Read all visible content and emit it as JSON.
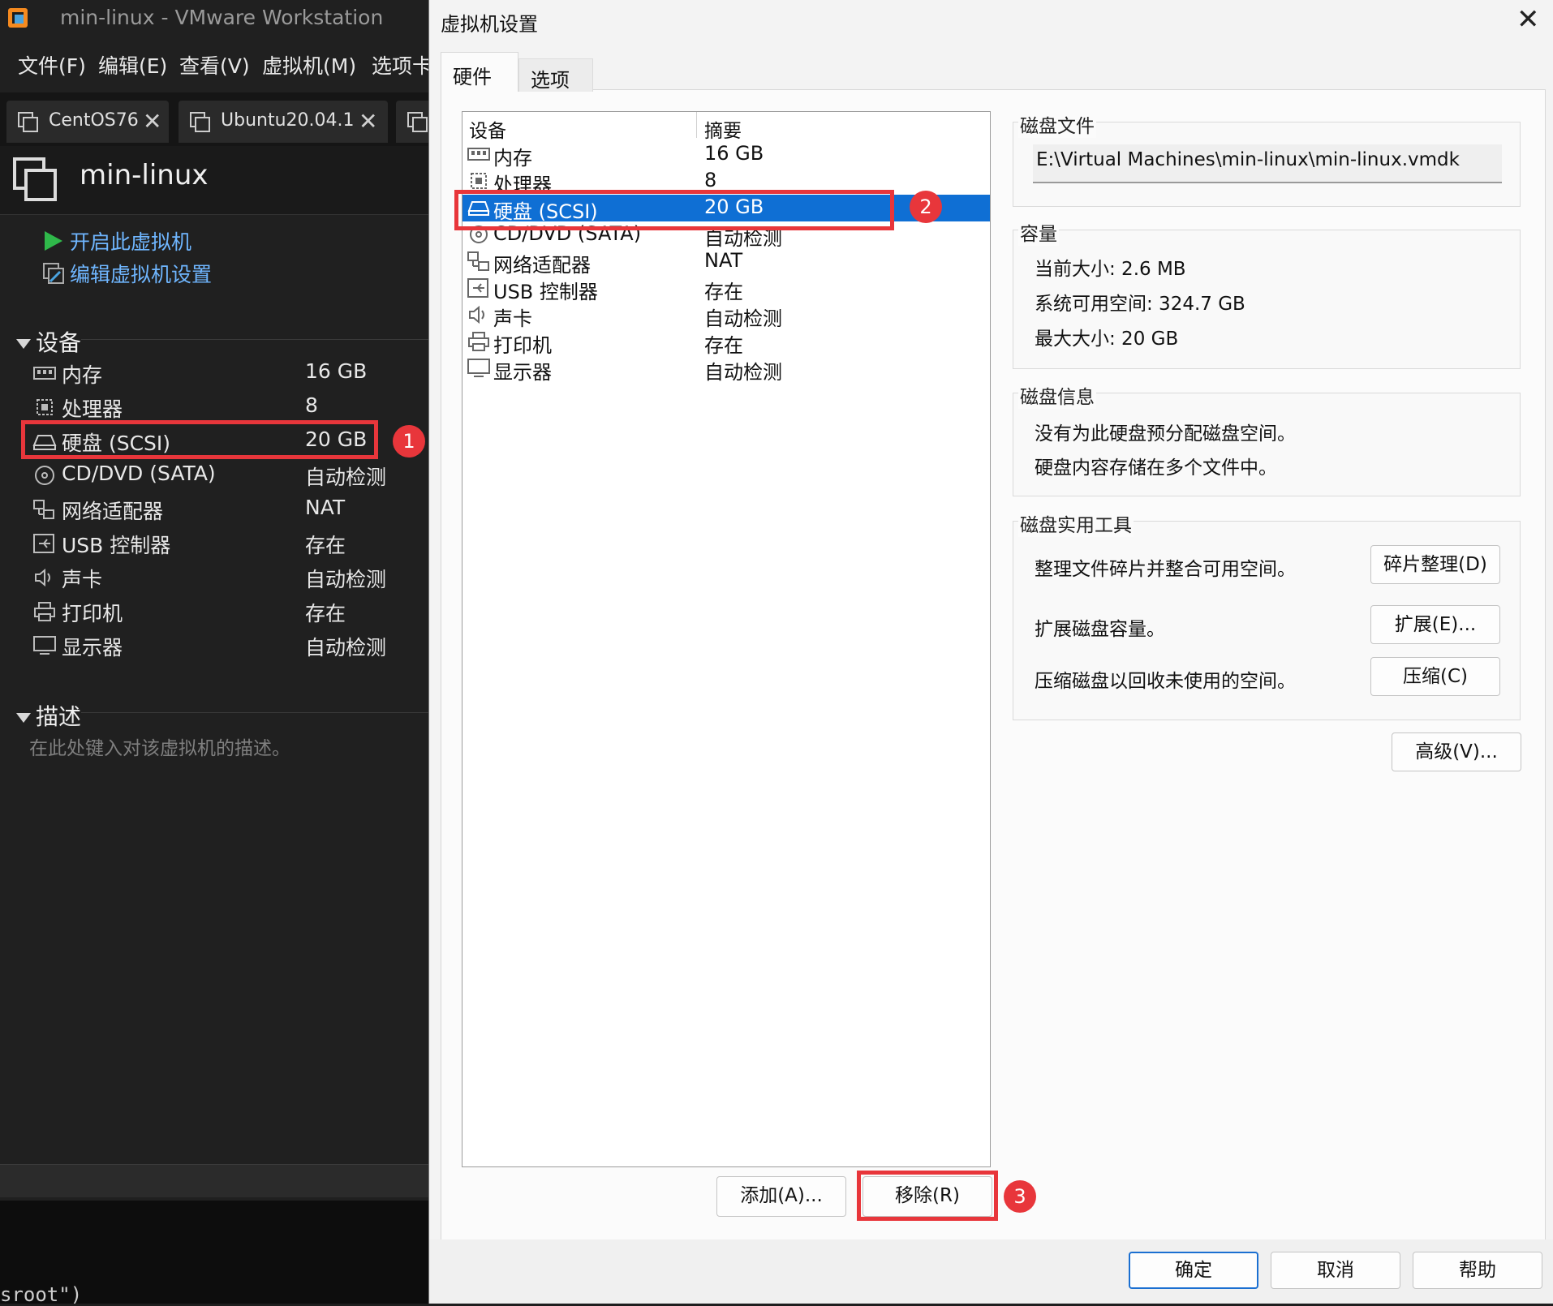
{
  "vmware": {
    "title": "min-linux - VMware Workstation",
    "menu": [
      "文件(F)",
      "编辑(E)",
      "查看(V)",
      "虚拟机(M)",
      "选项卡"
    ],
    "tabs": [
      "CentOS76",
      "Ubuntu20.04.1"
    ],
    "close_glyph": "✕",
    "vm_name": "min-linux",
    "actions": [
      "开启此虚拟机",
      "编辑虚拟机设置"
    ],
    "devices_header": "设备",
    "devices": [
      {
        "name": "内存",
        "value": "16 GB",
        "icon": "memory-icon"
      },
      {
        "name": "处理器",
        "value": "8",
        "icon": "cpu-icon"
      },
      {
        "name": "硬盘 (SCSI)",
        "value": "20 GB",
        "icon": "harddisk-icon"
      },
      {
        "name": "CD/DVD (SATA)",
        "value": "自动检测",
        "icon": "cdrom-icon"
      },
      {
        "name": "网络适配器",
        "value": "NAT",
        "icon": "network-icon"
      },
      {
        "name": "USB 控制器",
        "value": "存在",
        "icon": "usb-icon"
      },
      {
        "name": "声卡",
        "value": "自动检测",
        "icon": "sound-icon"
      },
      {
        "name": "打印机",
        "value": "存在",
        "icon": "printer-icon"
      },
      {
        "name": "显示器",
        "value": "自动检测",
        "icon": "monitor-icon"
      }
    ],
    "description_header": "描述",
    "description_placeholder": "在此处键入对该虚拟机的描述。",
    "console_text": "sroot\")"
  },
  "dialog": {
    "title": "虚拟机设置",
    "close_glyph": "✕",
    "tabs": [
      "硬件",
      "选项"
    ],
    "list_headers": [
      "设备",
      "摘要"
    ],
    "devices": [
      {
        "name": "内存",
        "value": "16 GB"
      },
      {
        "name": "处理器",
        "value": "8"
      },
      {
        "name": "硬盘 (SCSI)",
        "value": "20 GB"
      },
      {
        "name": "CD/DVD (SATA)",
        "value": "自动检测"
      },
      {
        "name": "网络适配器",
        "value": "NAT"
      },
      {
        "name": "USB 控制器",
        "value": "存在"
      },
      {
        "name": "声卡",
        "value": "自动检测"
      },
      {
        "name": "打印机",
        "value": "存在"
      },
      {
        "name": "显示器",
        "value": "自动检测"
      }
    ],
    "selected_index": 2,
    "disk_file": {
      "label": "磁盘文件",
      "path": "E:\\Virtual Machines\\min-linux\\min-linux.vmdk"
    },
    "capacity": {
      "label": "容量",
      "current": "当前大小: 2.6 MB",
      "available": "系统可用空间: 324.7 GB",
      "max": "最大大小: 20 GB"
    },
    "disk_info": {
      "label": "磁盘信息",
      "line1": "没有为此硬盘预分配磁盘空间。",
      "line2": "硬盘内容存储在多个文件中。"
    },
    "utilities": {
      "label": "磁盘实用工具",
      "defrag_text": "整理文件碎片并整合可用空间。",
      "defrag_button": "碎片整理(D)",
      "expand_text": "扩展磁盘容量。",
      "expand_button": "扩展(E)...",
      "compact_text": "压缩磁盘以回收未使用的空间。",
      "compact_button": "压缩(C)"
    },
    "advanced_button": "高级(V)...",
    "add_button": "添加(A)...",
    "remove_button": "移除(R)",
    "ok_button": "确定",
    "cancel_button": "取消",
    "help_button": "帮助"
  },
  "annotations": [
    "1",
    "2",
    "3"
  ],
  "colors": {
    "selection": "#0f6fd4",
    "annotation": "#e8363b",
    "link": "#6fb6ff",
    "play": "#2fb84a"
  }
}
